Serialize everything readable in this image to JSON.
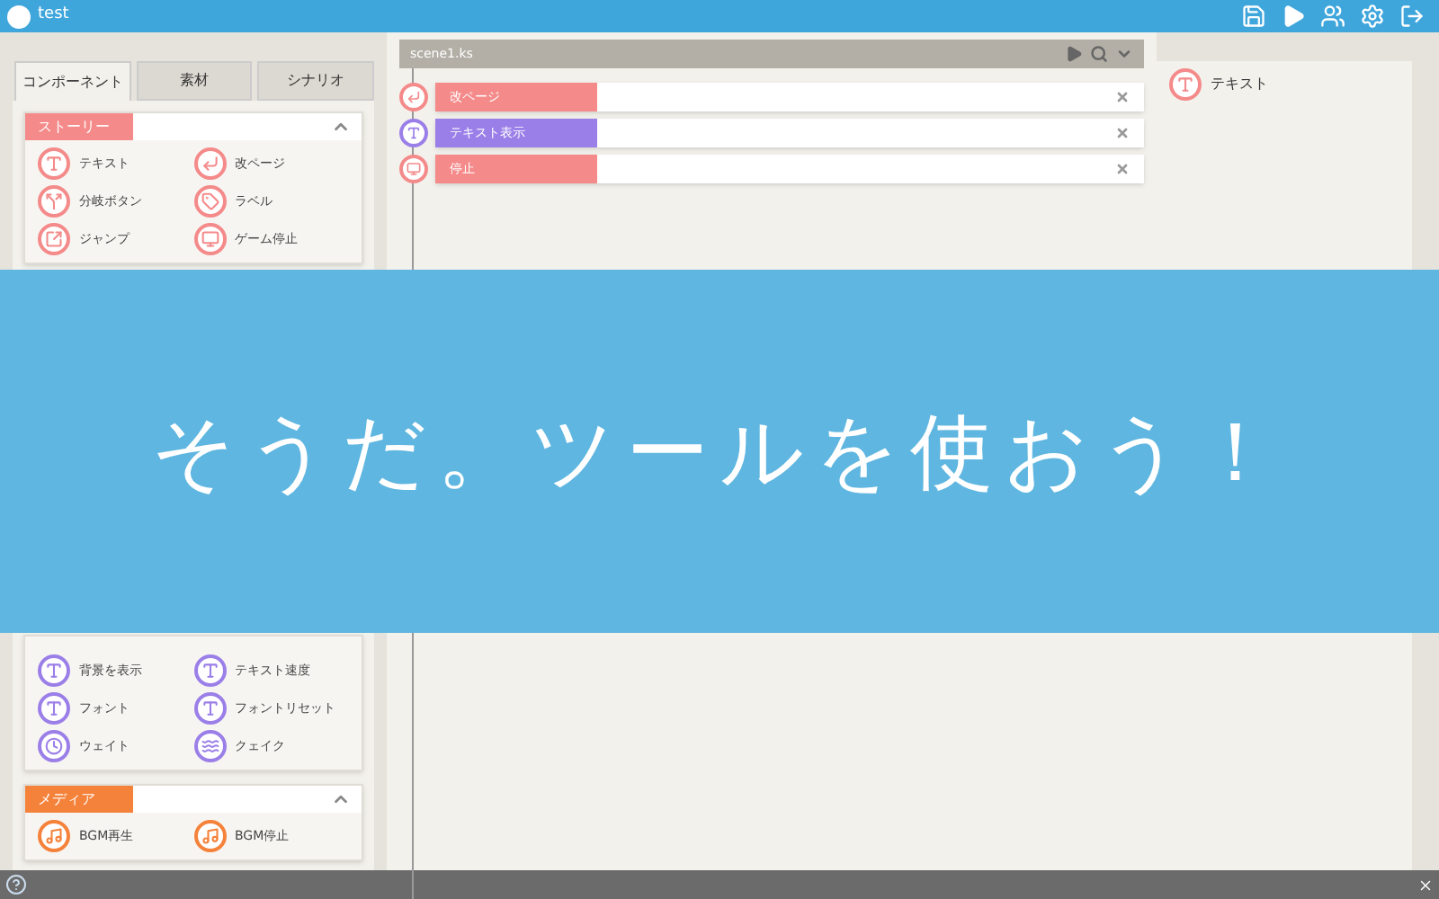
{
  "app": {
    "title": "test"
  },
  "left_tabs": [
    {
      "label": "コンポーネント",
      "selected": true
    },
    {
      "label": "素材",
      "selected": false
    },
    {
      "label": "シナリオ",
      "selected": false
    }
  ],
  "sections": [
    {
      "title": "ストーリー",
      "color": "#f48a8a",
      "expanded": true,
      "items": [
        "テキスト",
        "改ページ",
        "分岐ボタン",
        "ラベル",
        "ジャンプ",
        "ゲーム停止"
      ]
    },
    {
      "color": "#9b7fe8",
      "items": [
        "背景を表示",
        "テキスト速度",
        "フォント",
        "フォントリセット",
        "ウェイト",
        "クェイク"
      ]
    },
    {
      "title": "メディア",
      "color": "#f5823a",
      "expanded": true,
      "items": [
        "BGM再生",
        "BGM停止"
      ]
    }
  ],
  "scene": {
    "file": "scene1.ks",
    "items": [
      {
        "label": "改ページ",
        "color": "#f48a8a"
      },
      {
        "label": "テキスト表示",
        "color": "#9b7fe8"
      },
      {
        "label": "停止",
        "color": "#f48a8a"
      }
    ]
  },
  "right_panel": {
    "items": [
      "テキスト"
    ]
  },
  "banner": {
    "text": "そうだ。ツールを使おう！"
  }
}
